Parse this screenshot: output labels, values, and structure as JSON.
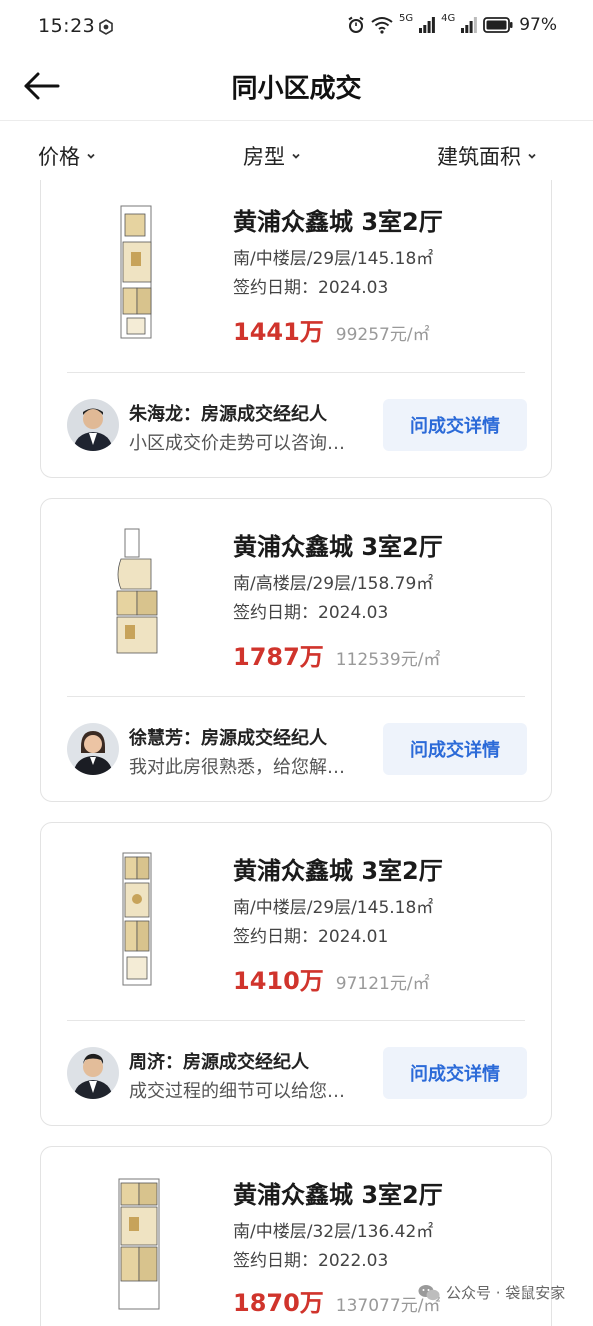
{
  "status": {
    "time": "15:23",
    "sig1": "5G",
    "sig2": "4G",
    "battery": "97%"
  },
  "header": {
    "title": "同小区成交"
  },
  "filters": [
    {
      "label": "价格"
    },
    {
      "label": "房型"
    },
    {
      "label": "建筑面积"
    }
  ],
  "listings": [
    {
      "name": "黄浦众鑫城 3室2厅",
      "spec": "南/中楼层/29层/145.18㎡",
      "sign_date": "签约日期：2024.03",
      "total": "1441万",
      "unit": "99257元/㎡",
      "agent": "朱海龙：房源成交经纪人",
      "message": "小区成交价走势可以咨询…",
      "button": "问成交详情"
    },
    {
      "name": "黄浦众鑫城 3室2厅",
      "spec": "南/高楼层/29层/158.79㎡",
      "sign_date": "签约日期：2024.03",
      "total": "1787万",
      "unit": "112539元/㎡",
      "agent": "徐慧芳：房源成交经纪人",
      "message": "我对此房很熟悉，给您解…",
      "button": "问成交详情"
    },
    {
      "name": "黄浦众鑫城 3室2厅",
      "spec": "南/中楼层/29层/145.18㎡",
      "sign_date": "签约日期：2024.01",
      "total": "1410万",
      "unit": "97121元/㎡",
      "agent": "周济：房源成交经纪人",
      "message": "成交过程的细节可以给您…",
      "button": "问成交详情"
    },
    {
      "name": "黄浦众鑫城 3室2厅",
      "spec": "南/中楼层/32层/136.42㎡",
      "sign_date": "签约日期：2022.03",
      "total": "1870万",
      "unit": "137077元/㎡"
    }
  ],
  "watermark": "公众号 · 袋鼠安家",
  "colors": {
    "price": "#d0342c",
    "button_text": "#2b6ad8",
    "button_bg": "#eef3fb"
  }
}
